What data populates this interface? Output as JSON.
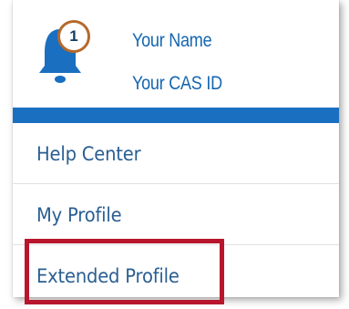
{
  "notifications": {
    "icon": "bell-icon",
    "count": "1",
    "badge_color": "#b56a2c",
    "icon_color": "#1a6fc0"
  },
  "user": {
    "name": "Your Name",
    "cas_id": "Your CAS ID"
  },
  "menu": {
    "items": [
      {
        "label": "Help Center"
      },
      {
        "label": "My Profile"
      },
      {
        "label": "Extended Profile"
      }
    ]
  },
  "highlight": {
    "target": "Extended Profile",
    "color": "#b7162d"
  },
  "colors": {
    "accent": "#1a6fc0",
    "link": "#2a5f92"
  }
}
